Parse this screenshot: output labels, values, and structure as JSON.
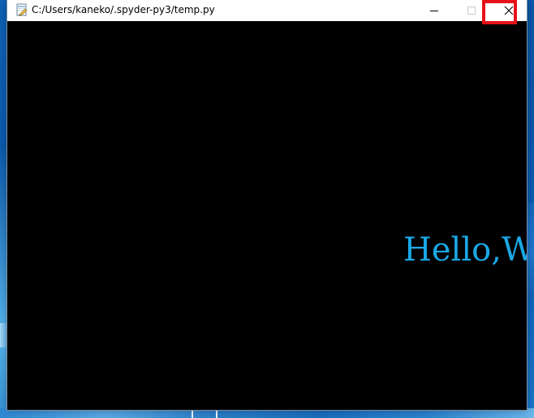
{
  "window": {
    "title": "C:/Users/kaneko/.spyder-py3/temp.py",
    "app_icon": "python-file-icon",
    "controls": {
      "minimize_icon": "minimize-icon",
      "maximize_icon": "maximize-icon",
      "close_icon": "close-icon"
    }
  },
  "canvas": {
    "background": "#000000",
    "text": "Hello,Wo",
    "text_color": "#1aa8e6"
  },
  "highlight": {
    "target": "close-button",
    "color": "#e8111b"
  }
}
